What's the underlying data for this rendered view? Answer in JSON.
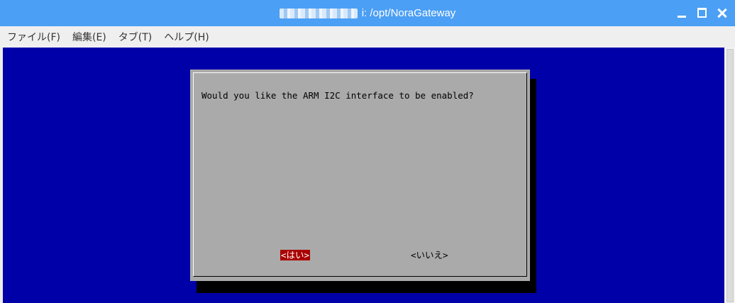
{
  "window": {
    "title": "i: /opt/NoraGateway"
  },
  "menu": {
    "items": [
      "ファイル(F)",
      "編集(E)",
      "タブ(T)",
      "ヘルプ(H)"
    ]
  },
  "dialog": {
    "message": "Would you like the ARM I2C interface to be enabled?",
    "yes_label": "<はい>",
    "no_label": "<いいえ>"
  },
  "colors": {
    "terminal_bg": "#0000a8",
    "dialog_bg": "#aaaaaa",
    "selected_button_bg": "#aa0000",
    "titlebar_bg": "#4b9ff4"
  }
}
